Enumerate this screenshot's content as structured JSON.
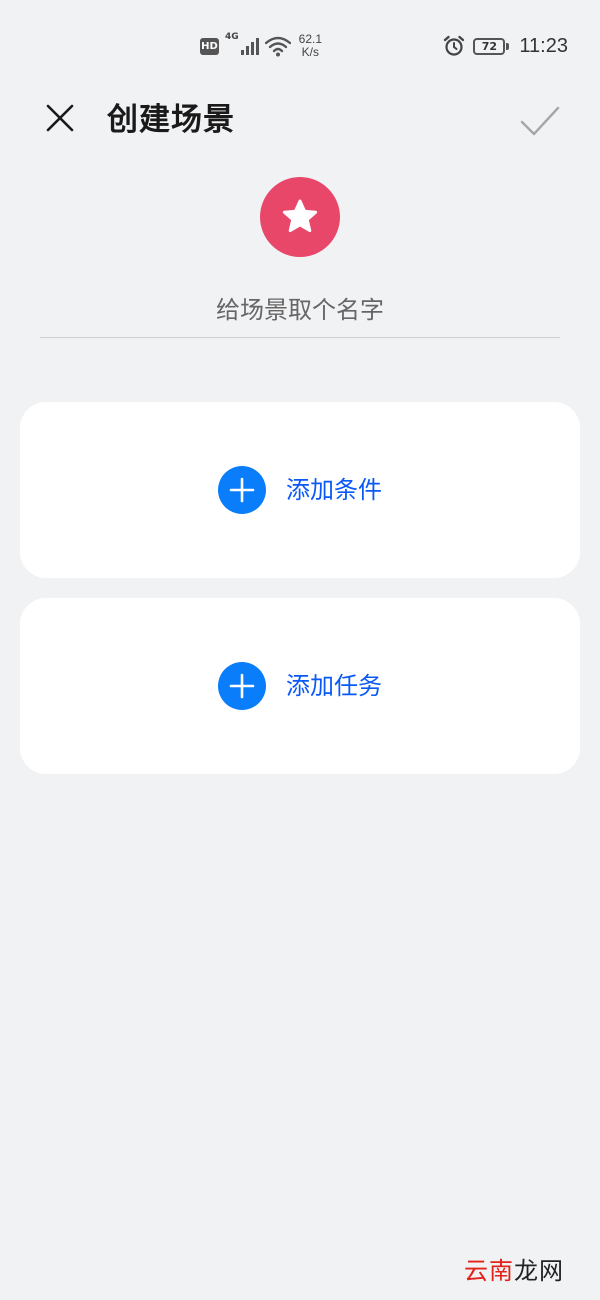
{
  "status_bar": {
    "hd_label": "HD",
    "network_type": "4G",
    "speed_value": "62.1",
    "speed_unit": "K/s",
    "battery": "72",
    "time": "11:23",
    "icons": [
      "signal-icon",
      "wifi-icon",
      "alarm-icon",
      "battery-icon"
    ]
  },
  "header": {
    "title": "创建场景",
    "close_icon": "close-icon",
    "confirm_icon": "check-icon"
  },
  "scene": {
    "icon": "star-icon",
    "icon_bg_color": "#e8476a",
    "name_value": "",
    "name_placeholder": "给场景取个名字"
  },
  "cards": {
    "condition": {
      "label": "添加条件",
      "icon": "plus-icon"
    },
    "task": {
      "label": "添加任务",
      "icon": "plus-icon"
    }
  },
  "colors": {
    "accent": "#0a7dfb",
    "accent_text": "#0a59f7",
    "background": "#f1f2f4",
    "card": "#ffffff"
  },
  "watermark": {
    "part1": "云南",
    "part2": "龙网"
  }
}
